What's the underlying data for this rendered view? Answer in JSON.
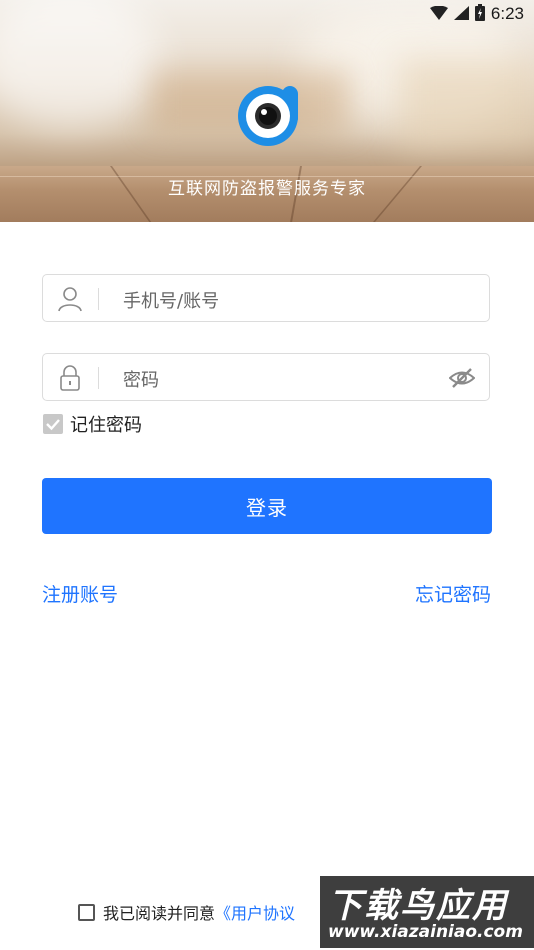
{
  "status_bar": {
    "time": "6:23",
    "wifi_icon": "wifi-icon",
    "signal_icon": "signal-icon",
    "battery_icon": "battery-charging-icon"
  },
  "header": {
    "tagline": "互联网防盗报警服务专家",
    "logo_icon": "camera-eye-logo"
  },
  "form": {
    "account_placeholder": "手机号/账号",
    "password_placeholder": "密码",
    "remember_label": "记住密码",
    "remember_checked": true,
    "login_label": "登录"
  },
  "links": {
    "register": "注册账号",
    "forgot": "忘记密码"
  },
  "agreement": {
    "prefix": "我已阅读并同意",
    "user_agreement": "《用户协议"
  },
  "watermark": {
    "line1": "下载鸟应用",
    "line2": "www.xiazainiao.com"
  },
  "colors": {
    "accent": "#1f74ff",
    "field_border": "#dcdcdc",
    "checkbox_checked": "#c8c8c8"
  }
}
